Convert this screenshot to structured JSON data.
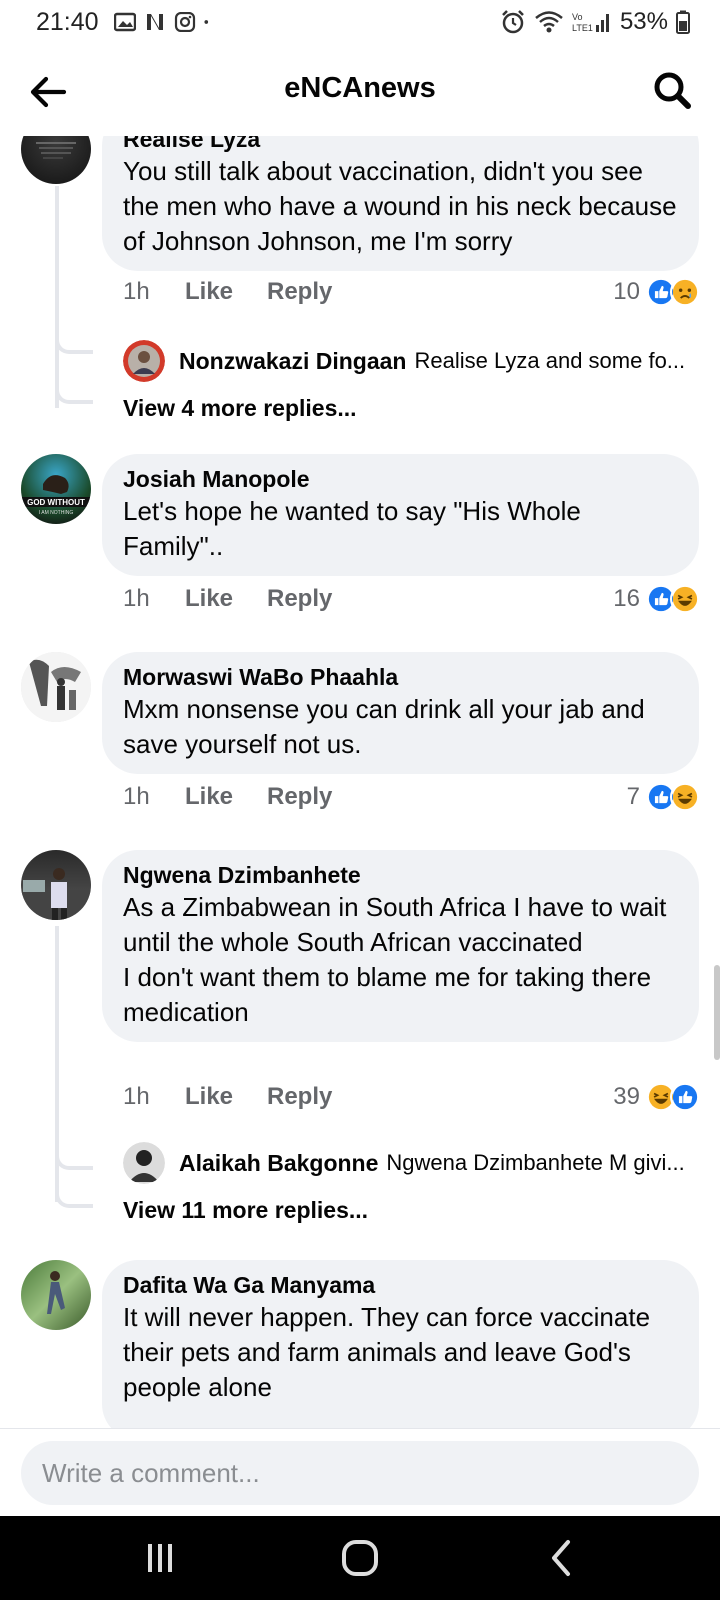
{
  "status_bar": {
    "time": "21:40",
    "battery": "53%"
  },
  "header": {
    "title": "eNCAnews"
  },
  "comments": [
    {
      "author": "Realise Lyza",
      "text": "You still talk about vaccination, didn't you see the men who have a wound in his neck because of Johnson Johnson, me I'm sorry",
      "time": "1h",
      "like": "Like",
      "reply": "Reply",
      "reaction_count": "10",
      "reply_preview": {
        "author": "Nonzwakazi Dingaan",
        "text": "Realise Lyza and some fo..."
      },
      "view_more": "View 4 more replies..."
    },
    {
      "author": "Josiah Manopole",
      "text": "Let's hope he wanted to say \"His Whole Family\"..",
      "time": "1h",
      "like": "Like",
      "reply": "Reply",
      "reaction_count": "16"
    },
    {
      "author": "Morwaswi WaBo Phaahla",
      "text": "Mxm nonsense you can drink all your jab and save yourself not us.",
      "time": "1h",
      "like": "Like",
      "reply": "Reply",
      "reaction_count": "7"
    },
    {
      "author": "Ngwena Dzimbanhete",
      "text_lines": [
        "As a Zimbabwean in South Africa I have to wait until the whole South African vaccinated",
        "I don't want them to blame me for taking there medication"
      ],
      "time": "1h",
      "like": "Like",
      "reply": "Reply",
      "reaction_count": "39",
      "reply_preview": {
        "author": "Alaikah Bakgonne",
        "text": "Ngwena Dzimbanhete M givi..."
      },
      "view_more": "View 11 more replies..."
    },
    {
      "author": "Dafita Wa Ga Manyama",
      "text": "It will never happen. They can force vaccinate their pets and farm animals and leave God's people alone"
    }
  ],
  "comment_input": {
    "placeholder": "Write a comment..."
  },
  "avatar_overlay_text": {
    "josiah": "GOD WITHOUT",
    "josiah_sub": "I AM NOTHING"
  },
  "colors": {
    "like_blue": "#1877f2",
    "haha_yellow": "#f7b125",
    "bubble_bg": "#f0f2f5",
    "meta_gray": "#65676b"
  }
}
